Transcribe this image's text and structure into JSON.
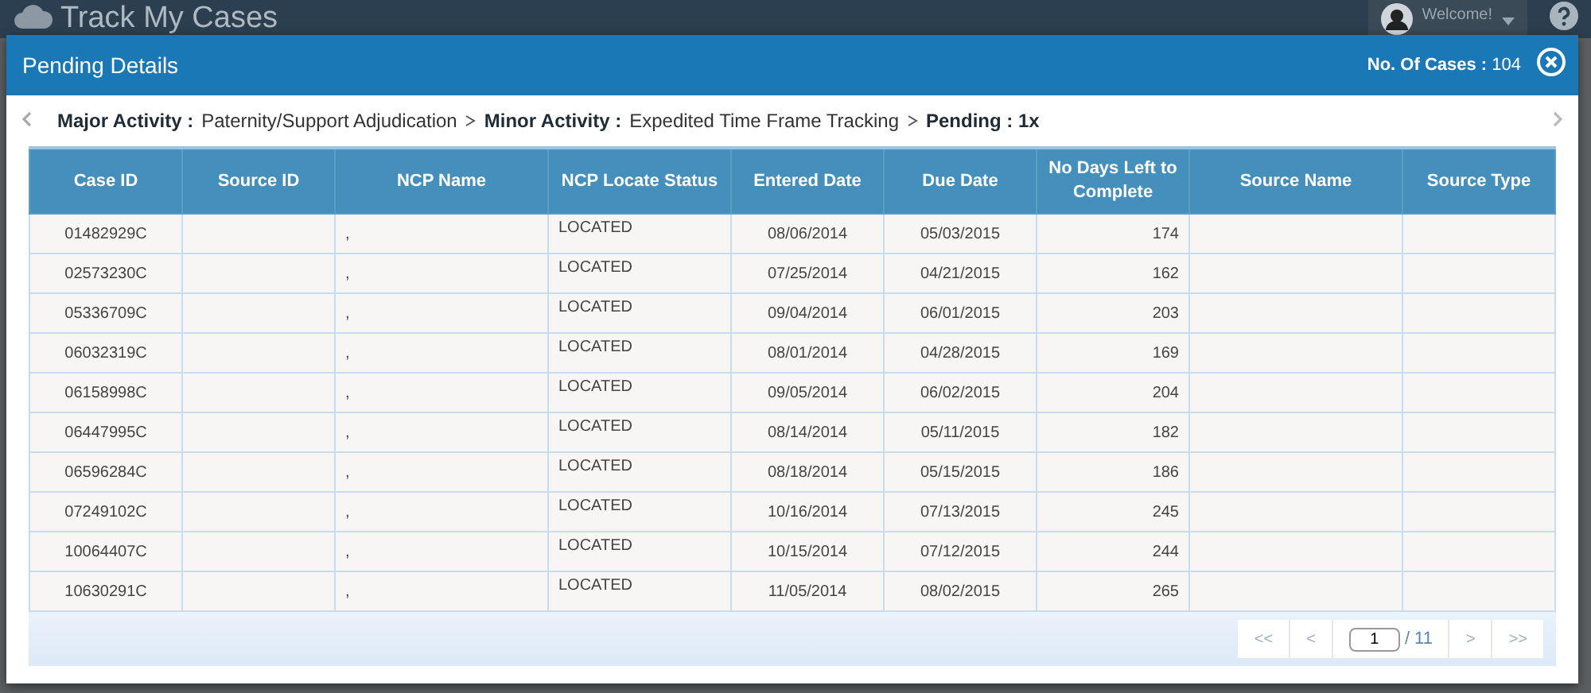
{
  "app": {
    "title": "Track My Cases",
    "welcome": "Welcome!"
  },
  "modal": {
    "title": "Pending Details",
    "count_label": "No. Of Cases :",
    "count": "104"
  },
  "breadcrumb": [
    {
      "label": "Major Activity :",
      "value": "Paternity/Support Adjudication"
    },
    {
      "label": "Minor Activity :",
      "value": "Expedited Time Frame Tracking"
    },
    {
      "label": "Pending : 1x"
    }
  ],
  "table": {
    "columns": [
      "Case ID",
      "Source ID",
      "NCP Name",
      "NCP Locate Status",
      "Entered Date",
      "Due Date",
      "No Days Left to Complete",
      "Source Name",
      "Source Type"
    ],
    "rows": [
      [
        "01482929C",
        "",
        ",",
        "LOCATED",
        "08/06/2014",
        "05/03/2015",
        "174",
        "",
        ""
      ],
      [
        "02573230C",
        "",
        ",",
        "LOCATED",
        "07/25/2014",
        "04/21/2015",
        "162",
        "",
        ""
      ],
      [
        "05336709C",
        "",
        ",",
        "LOCATED",
        "09/04/2014",
        "06/01/2015",
        "203",
        "",
        ""
      ],
      [
        "06032319C",
        "",
        ",",
        "LOCATED",
        "08/01/2014",
        "04/28/2015",
        "169",
        "",
        ""
      ],
      [
        "06158998C",
        "",
        ",",
        "LOCATED",
        "09/05/2014",
        "06/02/2015",
        "204",
        "",
        ""
      ],
      [
        "06447995C",
        "",
        ",",
        "LOCATED",
        "08/14/2014",
        "05/11/2015",
        "182",
        "",
        ""
      ],
      [
        "06596284C",
        "",
        ",",
        "LOCATED",
        "08/18/2014",
        "05/15/2015",
        "186",
        "",
        ""
      ],
      [
        "07249102C",
        "",
        ",",
        "LOCATED",
        "10/16/2014",
        "07/13/2015",
        "245",
        "",
        ""
      ],
      [
        "10064407C",
        "",
        ",",
        "LOCATED",
        "10/15/2014",
        "07/12/2015",
        "244",
        "",
        ""
      ],
      [
        "10630291C",
        "",
        ",",
        "LOCATED",
        "11/05/2014",
        "08/02/2015",
        "265",
        "",
        ""
      ]
    ]
  },
  "pager": {
    "first": "<<",
    "prev": "<",
    "page": "1",
    "total": "/ 11",
    "next": ">",
    "last": ">>"
  }
}
